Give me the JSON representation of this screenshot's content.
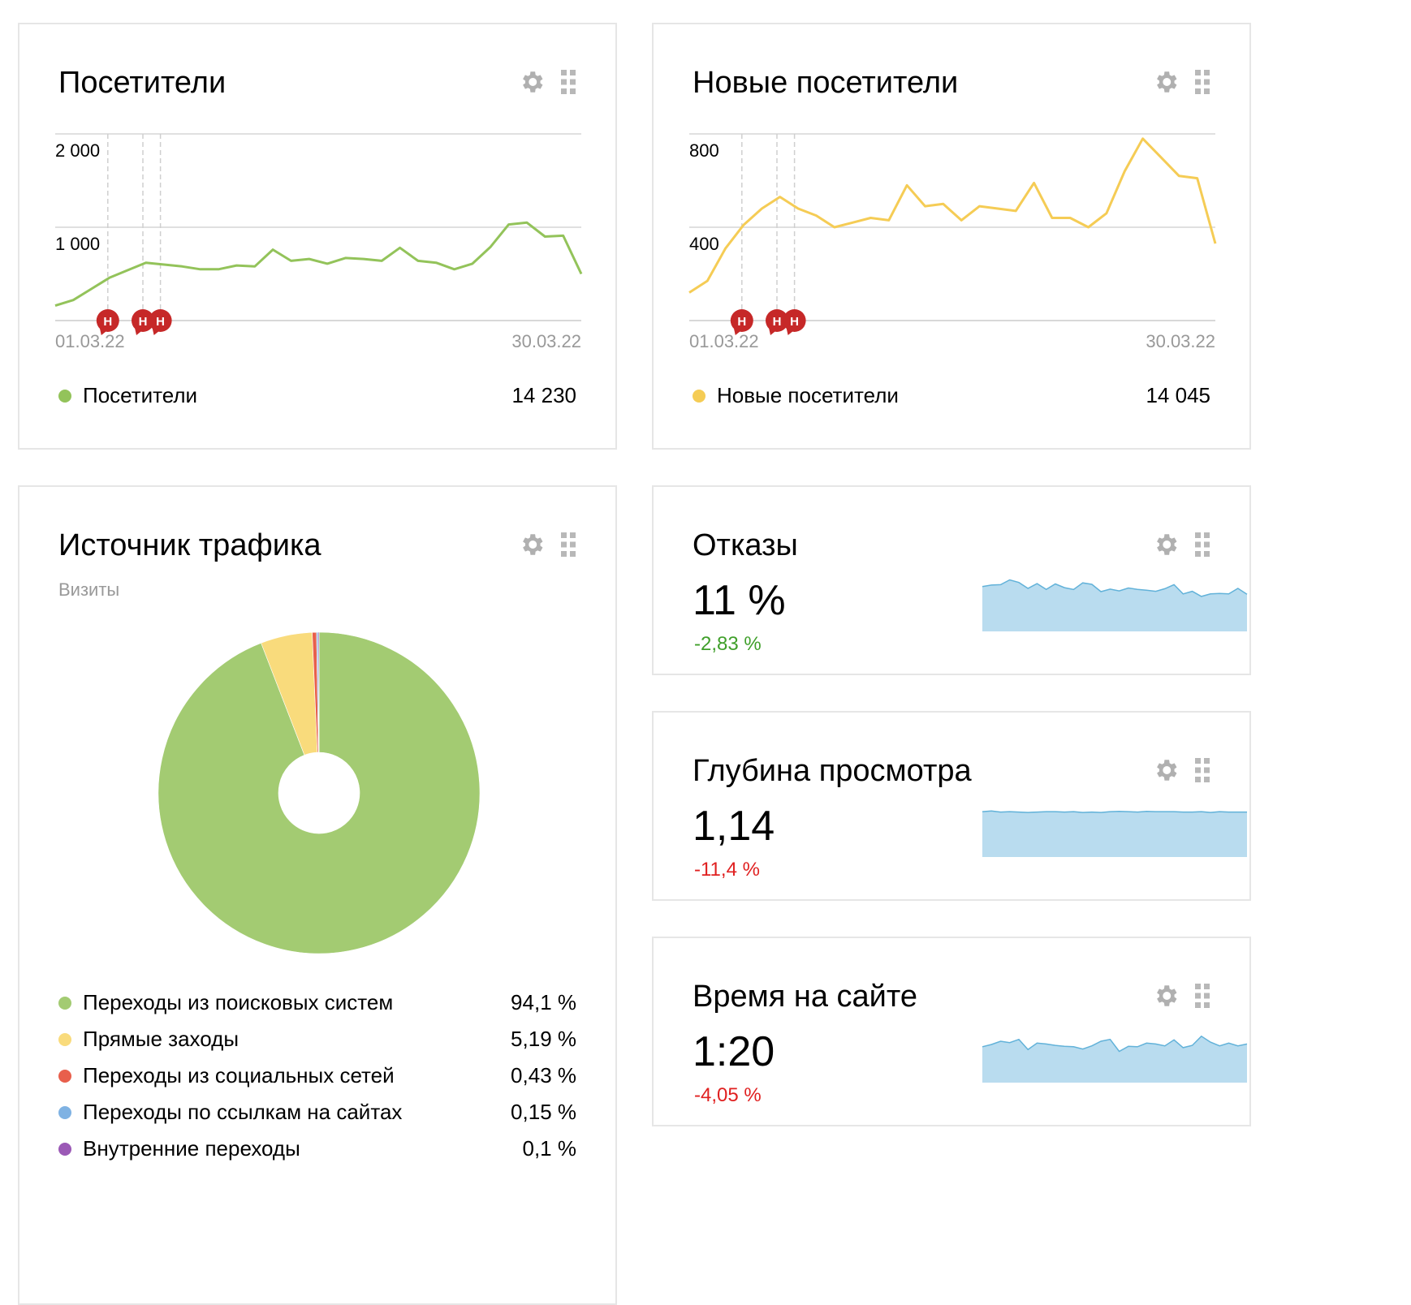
{
  "colors": {
    "green": "#93c35a",
    "yellow": "#f5cc55",
    "pie_green": "#a3cb72",
    "pie_yellow": "#f9db7c",
    "pie_red": "#e85f4c",
    "pie_blue": "#7fb2e3",
    "pie_purple": "#9b59b6",
    "spark_fill": "#b9dcef",
    "spark_line": "#62b2d9",
    "positive": "#3f9f2a",
    "negative": "#e02020",
    "annotation": "#c62828"
  },
  "widgets": {
    "visitors": {
      "title": "Посетители",
      "icons": [
        "gear-icon",
        "drag-handle-icon"
      ],
      "y_tick_labels": [
        "2 000",
        "1 000"
      ],
      "x_start": "01.03.22",
      "x_end": "30.03.22",
      "annotation_letter": "Н",
      "legend_label": "Посетители",
      "legend_value": "14 230",
      "chart_data": {
        "type": "line",
        "x_range": [
          "01.03.22",
          "31.03.22"
        ],
        "ylim": [
          0,
          2000
        ],
        "values": [
          160,
          220,
          340,
          460,
          540,
          620,
          600,
          580,
          550,
          550,
          590,
          580,
          760,
          640,
          660,
          610,
          670,
          660,
          640,
          780,
          640,
          620,
          550,
          610,
          790,
          1030,
          1050,
          900,
          910,
          500
        ],
        "annotation_days": [
          4,
          6,
          7
        ]
      }
    },
    "new_visitors": {
      "title": "Новые посетители",
      "icons": [
        "gear-icon",
        "drag-handle-icon"
      ],
      "y_tick_labels": [
        "800",
        "400"
      ],
      "x_start": "01.03.22",
      "x_end": "30.03.22",
      "annotation_letter": "Н",
      "legend_label": "Новые посетители",
      "legend_value": "14 045",
      "chart_data": {
        "type": "line",
        "x_range": [
          "01.03.22",
          "31.03.22"
        ],
        "ylim": [
          0,
          800
        ],
        "values": [
          120,
          170,
          310,
          410,
          480,
          530,
          480,
          450,
          400,
          420,
          440,
          430,
          580,
          490,
          500,
          430,
          490,
          480,
          470,
          590,
          440,
          440,
          400,
          460,
          640,
          780,
          700,
          620,
          610,
          330
        ],
        "annotation_days": [
          4,
          6,
          7
        ]
      }
    },
    "traffic_source": {
      "title": "Источник трафика",
      "subtitle": "Визиты",
      "icons": [
        "gear-icon",
        "drag-handle-icon"
      ],
      "chart_data": {
        "type": "pie",
        "slices": [
          {
            "label": "Переходы из поисковых систем",
            "value": 94.1,
            "display": "94,1 %",
            "color": "#a3cb72"
          },
          {
            "label": "Прямые заходы",
            "value": 5.19,
            "display": "5,19 %",
            "color": "#f9db7c"
          },
          {
            "label": "Переходы из социальных сетей",
            "value": 0.43,
            "display": "0,43 %",
            "color": "#e85f4c"
          },
          {
            "label": "Переходы по ссылкам на сайтах",
            "value": 0.15,
            "display": "0,15 %",
            "color": "#7fb2e3"
          },
          {
            "label": "Внутренние переходы",
            "value": 0.1,
            "display": "0,1 %",
            "color": "#9b59b6"
          }
        ]
      }
    },
    "bounces": {
      "title": "Отказы",
      "icons": [
        "gear-icon",
        "drag-handle-icon"
      ],
      "value": "11 %",
      "delta": "-2,83 %",
      "delta_trend": "positive",
      "chart_data": {
        "type": "area",
        "values": [
          12.2,
          12.6,
          12.7,
          14.0,
          13.3,
          11.7,
          13.0,
          11.4,
          12.9,
          11.9,
          11.4,
          13.2,
          12.8,
          10.8,
          11.5,
          11.0,
          11.8,
          11.4,
          11.2,
          10.9,
          11.6,
          12.7,
          10.2,
          10.9,
          9.5,
          10.2,
          10.3,
          10.2,
          11.7,
          10.1
        ],
        "ylim": [
          0,
          15
        ]
      }
    },
    "depth": {
      "title": "Глубина просмотра",
      "icons": [
        "gear-icon",
        "drag-handle-icon"
      ],
      "value": "1,14",
      "delta": "-11,4 %",
      "delta_trend": "negative",
      "chart_data": {
        "type": "area",
        "values": [
          1.15,
          1.17,
          1.14,
          1.15,
          1.14,
          1.13,
          1.14,
          1.15,
          1.15,
          1.14,
          1.15,
          1.13,
          1.14,
          1.13,
          1.15,
          1.16,
          1.15,
          1.14,
          1.16,
          1.15,
          1.15,
          1.15,
          1.14,
          1.14,
          1.15,
          1.13,
          1.15,
          1.14,
          1.14,
          1.14
        ],
        "ylim": [
          0,
          1.4
        ]
      }
    },
    "time_on_site": {
      "title": "Время на сайте",
      "icons": [
        "gear-icon",
        "drag-handle-icon"
      ],
      "value": "1:20",
      "delta": "-4,05 %",
      "delta_trend": "negative",
      "chart_data": {
        "type": "area",
        "values": [
          78,
          83,
          90,
          87,
          94,
          72,
          86,
          84,
          81,
          79,
          78,
          73,
          80,
          90,
          94,
          68,
          79,
          78,
          86,
          84,
          80,
          93,
          76,
          81,
          101,
          88,
          80,
          86,
          80,
          84
        ],
        "ylim": [
          0,
          120
        ]
      }
    }
  }
}
